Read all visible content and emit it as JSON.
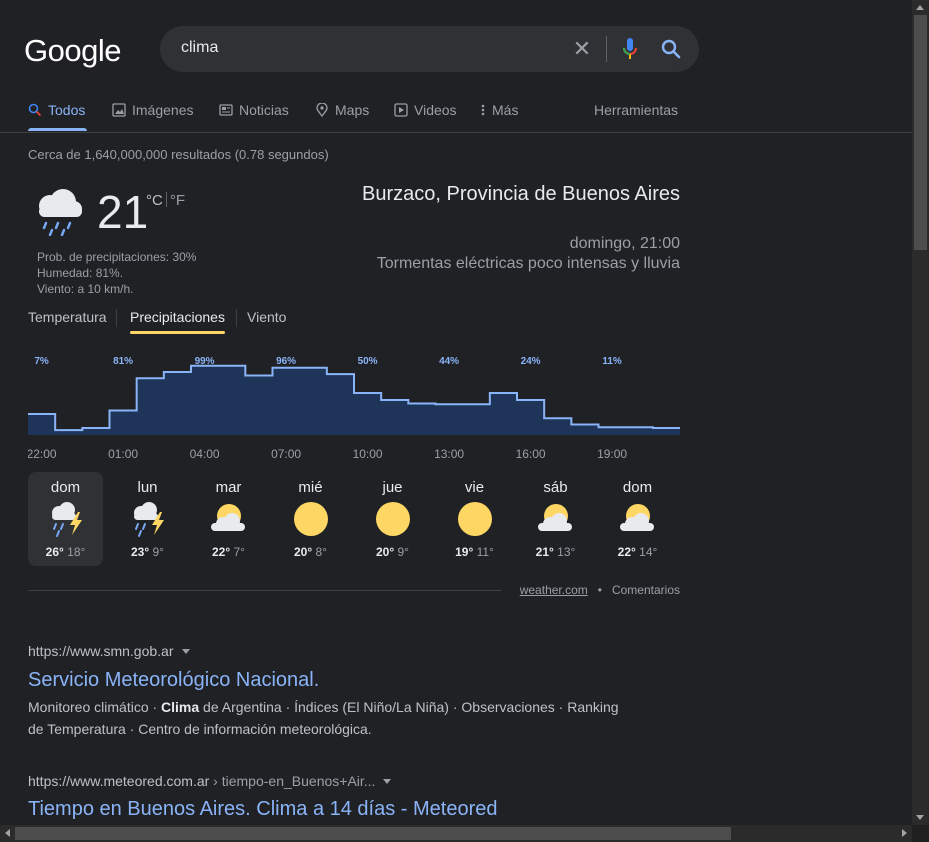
{
  "logo": "Google",
  "search": {
    "query": "clima"
  },
  "tabs": [
    {
      "label": "Todos",
      "icon": "search-icon",
      "active": true
    },
    {
      "label": "Imágenes",
      "icon": "image-icon"
    },
    {
      "label": "Noticias",
      "icon": "news-icon"
    },
    {
      "label": "Maps",
      "icon": "map-pin-icon"
    },
    {
      "label": "Videos",
      "icon": "play-icon"
    },
    {
      "label": "Más",
      "icon": "more-vert-icon"
    }
  ],
  "tools_label": "Herramientas",
  "result_stats": "Cerca de 1,640,000,000 resultados (0.78 segundos)",
  "weather": {
    "temp": "21",
    "unit_c": "°C",
    "unit_f": "°F",
    "details": [
      "Prob. de precipitaciones: 30%",
      "Humedad: 81%.",
      "Viento: a 10 km/h."
    ],
    "location": "Burzaco, Provincia de Buenos Aires",
    "datetime": "domingo, 21:00",
    "description": "Tormentas eléctricas poco intensas y lluvia",
    "tabs": [
      "Temperatura",
      "Precipitaciones",
      "Viento"
    ],
    "active_tab": "Precipitaciones",
    "source": "weather.com",
    "feedback": "Comentarios",
    "days": [
      {
        "name": "dom",
        "hi": "26°",
        "lo": "18°",
        "icon": "thunderstorm-icon"
      },
      {
        "name": "lun",
        "hi": "23°",
        "lo": "9°",
        "icon": "thunderstorm-icon"
      },
      {
        "name": "mar",
        "hi": "22°",
        "lo": "7°",
        "icon": "partly-cloudy-icon"
      },
      {
        "name": "mié",
        "hi": "20°",
        "lo": "8°",
        "icon": "sunny-icon"
      },
      {
        "name": "jue",
        "hi": "20°",
        "lo": "9°",
        "icon": "sunny-icon"
      },
      {
        "name": "vie",
        "hi": "19°",
        "lo": "11°",
        "icon": "sunny-icon"
      },
      {
        "name": "sáb",
        "hi": "21°",
        "lo": "13°",
        "icon": "partly-cloudy-icon"
      },
      {
        "name": "dom",
        "hi": "22°",
        "lo": "14°",
        "icon": "partly-cloudy-icon"
      }
    ]
  },
  "chart_data": {
    "type": "area",
    "x": [
      "22:00",
      "23:00",
      "00:00",
      "01:00",
      "02:00",
      "03:00",
      "04:00",
      "05:00",
      "06:00",
      "07:00",
      "08:00",
      "09:00",
      "10:00",
      "11:00",
      "12:00",
      "13:00",
      "14:00",
      "15:00",
      "16:00",
      "17:00",
      "18:00",
      "19:00",
      "20:00",
      "21:00"
    ],
    "series": [
      {
        "values": [
          30,
          7,
          10,
          35,
          81,
          90,
          99,
          99,
          85,
          96,
          96,
          87,
          60,
          50,
          45,
          44,
          44,
          60,
          50,
          24,
          15,
          11,
          11,
          10
        ]
      }
    ],
    "point_labels": [
      {
        "x": "22:00",
        "label": "7%"
      },
      {
        "x": "01:00",
        "label": "81%"
      },
      {
        "x": "04:00",
        "label": "99%"
      },
      {
        "x": "07:00",
        "label": "96%"
      },
      {
        "x": "10:00",
        "label": "50%"
      },
      {
        "x": "13:00",
        "label": "44%"
      },
      {
        "x": "16:00",
        "label": "24%"
      },
      {
        "x": "19:00",
        "label": "11%"
      }
    ],
    "tick_labels": [
      "22:00",
      "01:00",
      "04:00",
      "07:00",
      "10:00",
      "13:00",
      "16:00",
      "19:00"
    ],
    "ylim": [
      0,
      100
    ],
    "fill_color": "#1e3459",
    "line_color": "#8ab4f8",
    "grid": false
  },
  "results": [
    {
      "url": "https://www.smn.gob.ar",
      "path": "",
      "title": "Servicio Meteorológico Nacional.",
      "snippet_parts": [
        "Monitoreo climático · ",
        "Clima",
        " de Argentina · Índices (El Niño/La Niña) · Observaciones · Ranking de Temperatura · Centro de información meteorológica."
      ]
    },
    {
      "url": "https://www.meteored.com.ar",
      "path": " › tiempo-en_Buenos+Air...",
      "title": "Tiempo en Buenos Aires. Clima a 14 días - Meteored"
    }
  ],
  "colors": {
    "background": "#202124",
    "link": "#8ab4f8",
    "accent_tab": "#fdd663",
    "chart_fill": "#1e3459"
  }
}
